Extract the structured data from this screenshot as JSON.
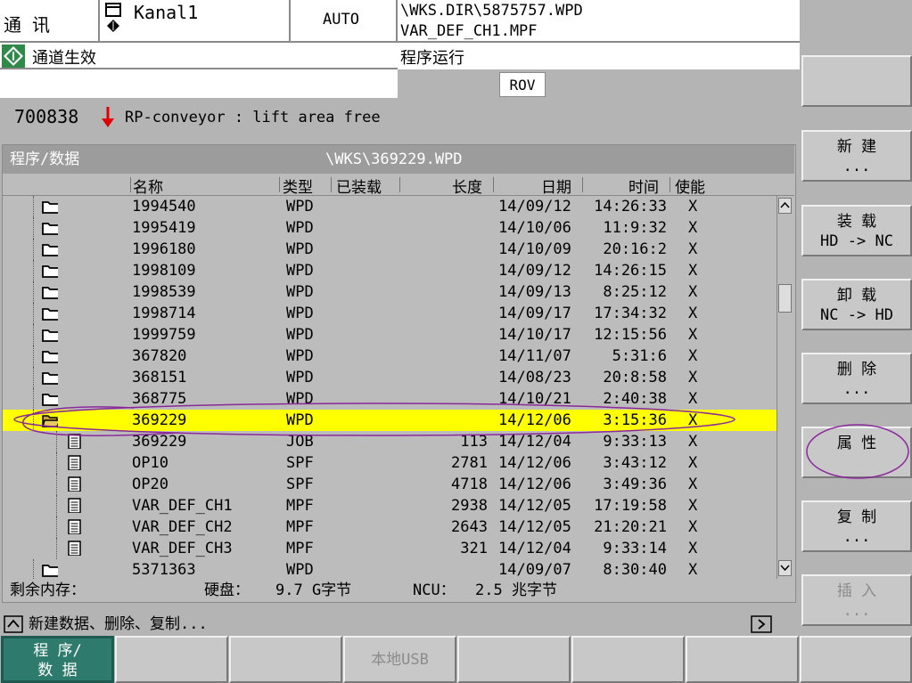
{
  "header": {
    "comm_label": "通 讯",
    "channel": "Kanal1",
    "mode": "AUTO",
    "path_line1": "\\WKS.DIR\\5875757.WPD",
    "path_line2": "VAR_DEF_CH1.MPF",
    "channel_status": "通道生效",
    "program_status": "程序运行",
    "rov": "ROV"
  },
  "alarm": {
    "number": "700838",
    "text": "RP-conveyor : lift area free"
  },
  "panel": {
    "title": "程序/数据",
    "path": "\\WKS\\369229.WPD",
    "columns": {
      "name": "名称",
      "type": "类型",
      "loaded": "已装载",
      "length": "长度",
      "date": "日期",
      "time": "时间",
      "enable": "使能"
    },
    "rows": [
      {
        "icon": "folder",
        "name": "1994540",
        "type": "WPD",
        "length": "",
        "date": "14/09/12",
        "time": "14:26:33",
        "enable": "X"
      },
      {
        "icon": "folder",
        "name": "1995419",
        "type": "WPD",
        "length": "",
        "date": "14/10/06",
        "time": "11:9:32",
        "enable": "X"
      },
      {
        "icon": "folder",
        "name": "1996180",
        "type": "WPD",
        "length": "",
        "date": "14/10/09",
        "time": "20:16:2",
        "enable": "X"
      },
      {
        "icon": "folder",
        "name": "1998109",
        "type": "WPD",
        "length": "",
        "date": "14/09/12",
        "time": "14:26:15",
        "enable": "X"
      },
      {
        "icon": "folder",
        "name": "1998539",
        "type": "WPD",
        "length": "",
        "date": "14/09/13",
        "time": "8:25:12",
        "enable": "X"
      },
      {
        "icon": "folder",
        "name": "1998714",
        "type": "WPD",
        "length": "",
        "date": "14/09/17",
        "time": "17:34:32",
        "enable": "X"
      },
      {
        "icon": "folder",
        "name": "1999759",
        "type": "WPD",
        "length": "",
        "date": "14/10/17",
        "time": "12:15:56",
        "enable": "X"
      },
      {
        "icon": "folder",
        "name": "367820",
        "type": "WPD",
        "length": "",
        "date": "14/11/07",
        "time": "5:31:6",
        "enable": "X"
      },
      {
        "icon": "folder",
        "name": "368151",
        "type": "WPD",
        "length": "",
        "date": "14/08/23",
        "time": "20:8:58",
        "enable": "X"
      },
      {
        "icon": "folder",
        "name": "368775",
        "type": "WPD",
        "length": "",
        "date": "14/10/21",
        "time": "2:40:38",
        "enable": "X"
      },
      {
        "icon": "folder-open",
        "name": "369229",
        "type": "WPD",
        "length": "",
        "date": "14/12/06",
        "time": "3:15:36",
        "enable": "X",
        "selected": true
      },
      {
        "icon": "file",
        "name": "369229",
        "type": "JOB",
        "length": "113",
        "date": "14/12/04",
        "time": "9:33:13",
        "enable": "X"
      },
      {
        "icon": "file",
        "name": "OP10",
        "type": "SPF",
        "length": "2781",
        "date": "14/12/06",
        "time": "3:43:12",
        "enable": "X"
      },
      {
        "icon": "file",
        "name": "OP20",
        "type": "SPF",
        "length": "4718",
        "date": "14/12/06",
        "time": "3:49:36",
        "enable": "X"
      },
      {
        "icon": "file",
        "name": "VAR_DEF_CH1",
        "type": "MPF",
        "length": "2938",
        "date": "14/12/05",
        "time": "17:19:58",
        "enable": "X"
      },
      {
        "icon": "file",
        "name": "VAR_DEF_CH2",
        "type": "MPF",
        "length": "2643",
        "date": "14/12/05",
        "time": "21:20:21",
        "enable": "X"
      },
      {
        "icon": "file",
        "name": "VAR_DEF_CH3",
        "type": "MPF",
        "length": "321",
        "date": "14/12/04",
        "time": "9:33:14",
        "enable": "X"
      },
      {
        "icon": "folder",
        "name": "5371363",
        "type": "WPD",
        "length": "",
        "date": "14/09/07",
        "time": "8:30:40",
        "enable": "X"
      }
    ],
    "memory_label": "剩余内存：",
    "hd_label": "硬盘：",
    "hd_value": "9.7 G字节",
    "ncu_label": "NCU：",
    "ncu_value": "2.5 兆字节"
  },
  "hint": {
    "text": "新建数据、删除、复制..."
  },
  "softkeys_right": [
    {
      "line1": "",
      "line2": ""
    },
    {
      "line1": "新  建",
      "line2": "..."
    },
    {
      "line1": "装    载",
      "line2": "HD -> NC"
    },
    {
      "line1": "卸    载",
      "line2": "NC -> HD"
    },
    {
      "line1": "删  除",
      "line2": "..."
    },
    {
      "line1": "属  性",
      "line2": ""
    },
    {
      "line1": "复  制",
      "line2": "..."
    },
    {
      "line1": "插  入",
      "line2": "...",
      "disabled": true
    }
  ],
  "softkeys_bottom": [
    {
      "line1": "程 序/",
      "line2": "数 据",
      "active": true
    },
    {
      "line1": "",
      "line2": ""
    },
    {
      "line1": "",
      "line2": ""
    },
    {
      "line1": "本地USB",
      "line2": "",
      "disabled": true
    },
    {
      "line1": "",
      "line2": ""
    },
    {
      "line1": "",
      "line2": ""
    },
    {
      "line1": "",
      "line2": ""
    },
    {
      "line1": "",
      "line2": ""
    }
  ],
  "colors": {
    "selection": "#ffff00",
    "active_softkey": "#2e7b6e",
    "alarm_arrow": "#e00000",
    "annotation": "#8a2a9a"
  }
}
